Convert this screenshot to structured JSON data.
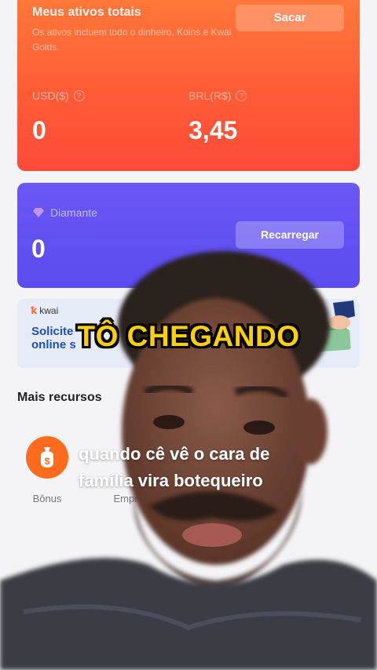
{
  "assets_card": {
    "title": "Meus ativos totais",
    "description": "Os ativos incluem todo o dinheiro, Koins e Kwai Golds.",
    "withdraw_label": "Sacar",
    "usd_label": "USD($)",
    "usd_value": "0",
    "brl_label": "BRL(R$)",
    "brl_value": "3,45"
  },
  "diamond_card": {
    "label": "Diamante",
    "value": "0",
    "recharge_label": "Recarregar"
  },
  "banner": {
    "brand": "kwai",
    "line1": "Solicite",
    "line2": "online s"
  },
  "more_resources": {
    "title": "Mais recursos",
    "items": [
      {
        "label": "Bônus",
        "icon": "money-bag-icon"
      },
      {
        "label": "Empr",
        "icon": ""
      }
    ]
  },
  "video_overlay": {
    "caption_main": "TÔ CHEGANDO",
    "caption_sub": "quando cê vê o cara de família vira botequeiro"
  },
  "colors": {
    "assets_card": "#ff5a36",
    "diamond_card": "#5a4cf0",
    "caption_main": "#ffd000",
    "bonus_icon": "#ff6b1c"
  }
}
